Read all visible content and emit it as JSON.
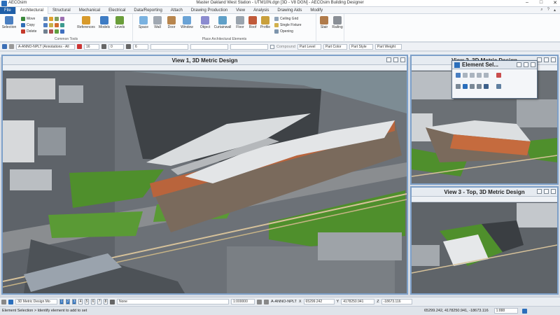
{
  "app": {
    "name": "AECOsim",
    "window_title": "Master Oakland West Station - UTM10N.dgn [3D - V8 DGN] - AECOsim Building Designer"
  },
  "menu": {
    "file_label": "File",
    "tabs": [
      "Architectural",
      "Structural",
      "Mechanical",
      "Electrical",
      "Data/Reporting",
      "Attach",
      "Drawing Production",
      "View",
      "Analysis",
      "Drawing Aids",
      "Modify"
    ],
    "active_tab": "Architectural"
  },
  "ribbon": {
    "common_tools": {
      "label": "Common Tools",
      "selection": "Selection",
      "move": "Move",
      "copy": "Copy",
      "delete": "Delete",
      "references": "References",
      "models": "Models",
      "levels": "Levels"
    },
    "architectural": {
      "label": "Place Architectural Elements",
      "space": "Space",
      "wall": "Wall",
      "door": "Door",
      "window": "Window",
      "object": "Object",
      "curtainwall": "Curtainwall",
      "floor": "Floor",
      "roof": "Roof",
      "profile": "Profile",
      "ceiling_grid": "Ceiling Grid",
      "single_fixture": "Single Fixture",
      "opening": "Opening",
      "stair": "Stair",
      "railing": "Railing"
    }
  },
  "attributes": {
    "level": "A-ANNO-NPLT (Annotations - All",
    "color_value": "16",
    "weight_value": "0",
    "style_value": "6",
    "compound_label": "Compound",
    "part_level": "Part Level",
    "part_color": "Part Color",
    "part_style": "Part Style",
    "part_weight": "Part Weight"
  },
  "views": [
    {
      "title": "View 1, 3D Metric Design"
    },
    {
      "title": "View 2, 3D Metric Design"
    },
    {
      "title": "View 3 - Top, 3D Metric Design"
    }
  ],
  "dialog": {
    "title": "Element Sel..."
  },
  "status": {
    "model": "3D Metric Design Mo",
    "view_numbers": [
      "1",
      "2",
      "3",
      "4",
      "5",
      "6",
      "7",
      "8"
    ],
    "snap": "None",
    "scale": "1:000000",
    "level": "A-ANNO-NPLT",
    "x_label": "X",
    "x_value": "65299.242",
    "y_label": "Y",
    "y_value": "4178250.941",
    "z_label": "Z",
    "z_value": "-18673.116",
    "prompt": "Element Selection > Identify element to add to set",
    "coords": "65299.242, 4178250.941, -18673.116",
    "last": "1:888"
  },
  "colors": {
    "accent": "#1f5fa8",
    "view_border": "#7da0c9",
    "canopy": "#d9dcde",
    "grass": "#4f8f2c"
  }
}
